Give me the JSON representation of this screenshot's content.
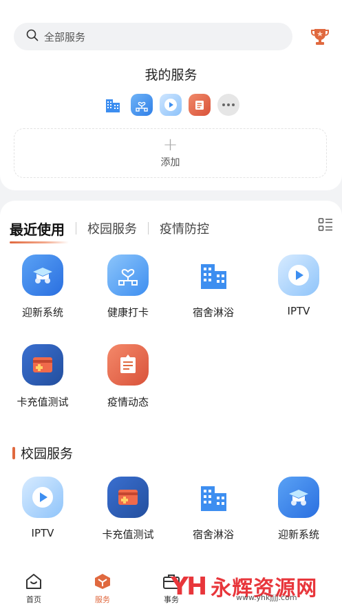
{
  "search": {
    "placeholder": "全部服务"
  },
  "my_services": {
    "title": "我的服务",
    "mini_icons": [
      "building-icon",
      "health-icon",
      "play-icon",
      "news-icon",
      "more-icon"
    ],
    "add_label": "添加",
    "add_symbol": "+"
  },
  "tabs": [
    {
      "label": "最近使用",
      "active": true
    },
    {
      "label": "校园服务",
      "active": false
    },
    {
      "label": "疫情防控",
      "active": false
    }
  ],
  "recent_apps": [
    {
      "label": "迎新系统",
      "icon": "graduation-icon"
    },
    {
      "label": "健康打卡",
      "icon": "health-icon"
    },
    {
      "label": "宿舍淋浴",
      "icon": "building-icon"
    },
    {
      "label": "IPTV",
      "icon": "play-icon"
    },
    {
      "label": "卡充值测试",
      "icon": "card-icon"
    },
    {
      "label": "疫情动态",
      "icon": "news-icon"
    }
  ],
  "campus_section": {
    "title": "校园服务",
    "apps": [
      {
        "label": "IPTV",
        "icon": "play-icon"
      },
      {
        "label": "卡充值测试",
        "icon": "card-icon"
      },
      {
        "label": "宿舍淋浴",
        "icon": "building-icon"
      },
      {
        "label": "迎新系统",
        "icon": "graduation-icon"
      }
    ]
  },
  "bottom_nav": [
    {
      "label": "首页",
      "icon": "home-icon",
      "active": false
    },
    {
      "label": "服务",
      "icon": "service-cube-icon",
      "active": true
    },
    {
      "label": "事务",
      "icon": "briefcase-icon",
      "active": false
    }
  ],
  "watermark": {
    "logo": "YH",
    "text": "永辉资源网",
    "url": "www.yhkjjjj.com"
  },
  "colors": {
    "accent": "#e0693f",
    "blue": "#3d8ef0",
    "watermark_red": "#e8363b"
  }
}
